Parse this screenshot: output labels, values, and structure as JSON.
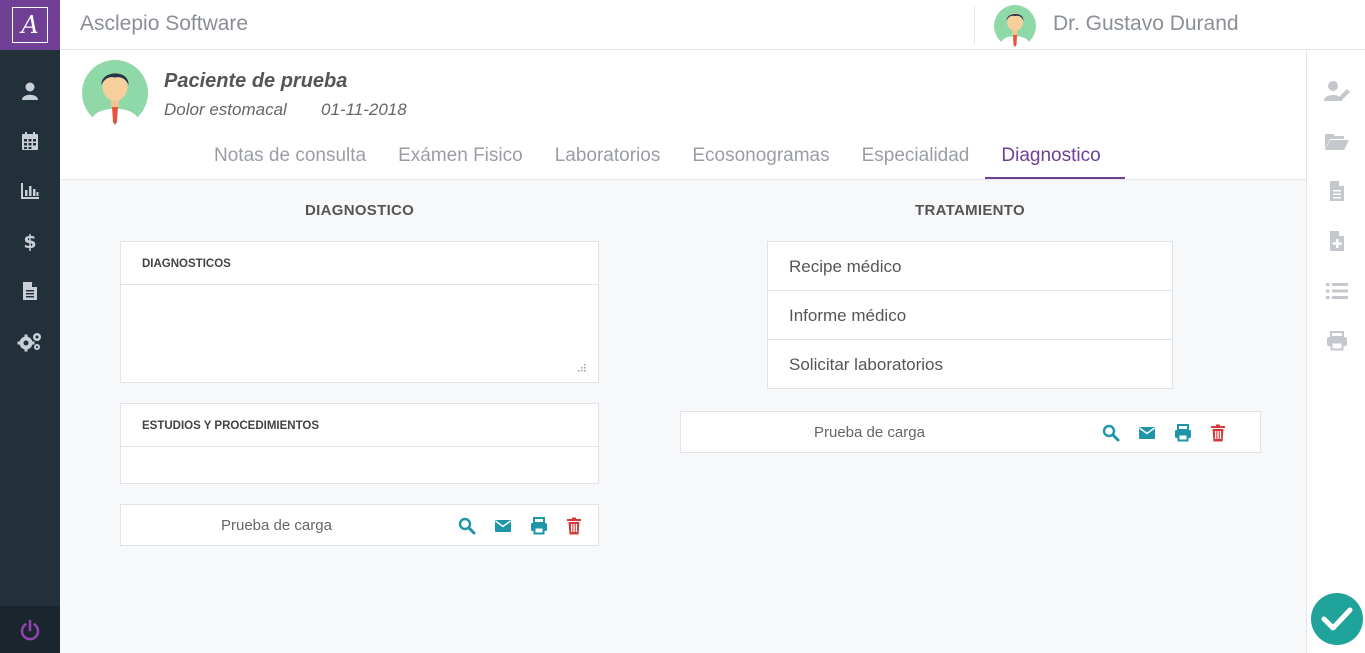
{
  "app": {
    "logo_letter": "A",
    "title": "Asclepio Software"
  },
  "user": {
    "name": "Dr. Gustavo Durand"
  },
  "patient": {
    "name": "Paciente de prueba",
    "reason": "Dolor estomacal",
    "date": "01-11-2018"
  },
  "tabs": [
    {
      "label": "Notas de consulta"
    },
    {
      "label": "Exámen Fisico"
    },
    {
      "label": "Laboratorios"
    },
    {
      "label": "Ecosonogramas"
    },
    {
      "label": "Especialidad"
    },
    {
      "label": "Diagnostico",
      "active": true
    }
  ],
  "diagnostico": {
    "title": "DIAGNOSTICO",
    "diagnosticos_label": "DIAGNOSTICOS",
    "estudios_label": "ESTUDIOS Y PROCEDIMIENTOS",
    "file": {
      "name": "Prueba de carga"
    }
  },
  "tratamiento": {
    "title": "TRATAMIENTO",
    "items": [
      {
        "label": "Recipe médico"
      },
      {
        "label": "Informe médico"
      },
      {
        "label": "Solicitar laboratorios"
      }
    ],
    "file": {
      "name": "Prueba de carga"
    }
  },
  "left_nav": [
    "user-icon",
    "calendar-icon",
    "chart-icon",
    "dollar-icon",
    "document-icon",
    "cogs-icon"
  ],
  "right_nav": [
    "user-edit-icon",
    "folder-open-icon",
    "file-icon",
    "file-medical-icon",
    "list-icon",
    "print-icon"
  ],
  "colors": {
    "brand": "#6f3f95",
    "sidebar": "#22303a",
    "action": "#1f96a8",
    "delete": "#d43a3a",
    "confirm": "#1fa39a"
  }
}
